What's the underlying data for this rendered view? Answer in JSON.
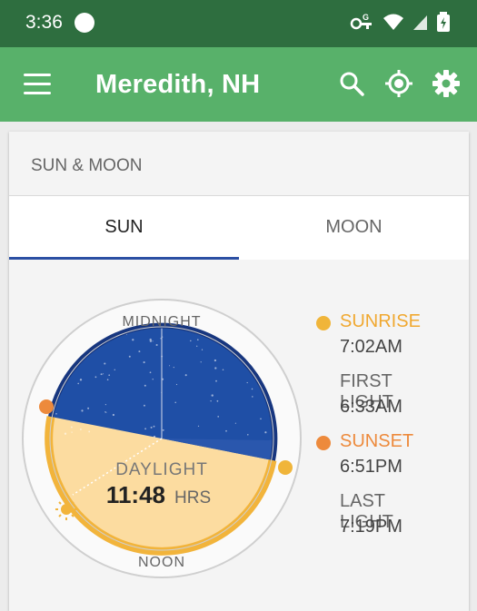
{
  "status": {
    "time": "3:36"
  },
  "app": {
    "title": "Meredith, NH"
  },
  "card": {
    "title": "SUN & MOON"
  },
  "tabs": [
    {
      "label": "SUN",
      "selected": true
    },
    {
      "label": "MOON",
      "selected": false
    }
  ],
  "dial": {
    "top_label": "MIDNIGHT",
    "bottom_label": "NOON",
    "center_label": "DAYLIGHT",
    "duration_value": "11:48",
    "duration_unit": "HRS"
  },
  "events": [
    {
      "label": "SUNRISE",
      "time": "7:02AM",
      "color": "#f0b53a"
    },
    {
      "label": "FIRST LIGHT",
      "time": "6:33AM"
    },
    {
      "label": "SUNSET",
      "time": "6:51PM",
      "color": "#ed8a3c"
    },
    {
      "label": "LAST LIGHT",
      "time": "7:19PM"
    }
  ],
  "colors": {
    "status_bar": "#2e6e3f",
    "app_bar": "#58b16a",
    "night": "#1f4fa6",
    "day": "#fcdca0",
    "day_arc": "#f2b43b",
    "tab_indicator": "#2b4fa3"
  }
}
